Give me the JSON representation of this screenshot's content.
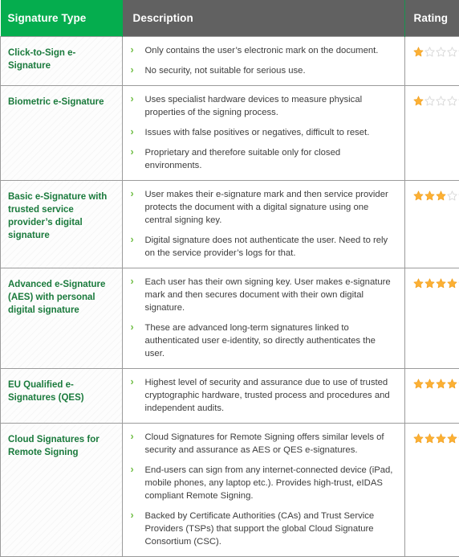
{
  "table": {
    "columns": [
      {
        "id": "type",
        "label": "Signature Type",
        "header_bg": "#05ad4e"
      },
      {
        "id": "description",
        "label": "Description",
        "header_bg": "#616161"
      },
      {
        "id": "rating",
        "label": "Rating",
        "header_bg": "#616161"
      }
    ],
    "max_rating": 5,
    "bullet_glyph": "›",
    "colors": {
      "brand_green": "#05ad4e",
      "header_gray": "#616161",
      "type_text_green": "#1a7a3c",
      "bullet_green": "#6fbe44",
      "star_filled": "#fcb034",
      "star_empty": "#d8d8d8",
      "border_gray": "#9b9b9b",
      "body_text": "#3d3d3d"
    },
    "rows": [
      {
        "type": "Click-to-Sign e-Signature",
        "bullets": [
          "Only contains the user’s electronic mark on the document.",
          "No security, not suitable for serious use."
        ],
        "rating": 1
      },
      {
        "type": "Biometric e-Signature",
        "bullets": [
          "Uses specialist hardware devices to measure physical properties of the signing process.",
          "Issues with false positives or negatives, difficult to reset.",
          "Proprietary and therefore suitable only for closed environments."
        ],
        "rating": 1
      },
      {
        "type": "Basic e-Signature with trusted service provider’s digital signature",
        "bullets": [
          "User makes their e-signature mark and then service provider protects the document with a digital signature using one central signing key.",
          "Digital signature does not authenticate the user. Need to rely on the service provider’s logs for that."
        ],
        "rating": 3
      },
      {
        "type": "Advanced e-Signature (AES) with personal digital signature",
        "bullets": [
          "Each user has their own signing key. User makes e-signature mark and then secures document with their own digital signature.",
          "These are advanced long-term signatures linked to authenticated user e-identity, so directly authenticates the user."
        ],
        "rating": 4
      },
      {
        "type": "EU Qualified e-Signatures (QES)",
        "bullets": [
          "Highest level of security and assurance due to use of trusted cryptographic hardware, trusted process and procedures and independent audits."
        ],
        "rating": 4
      },
      {
        "type": "Cloud Signatures for Remote Signing",
        "bullets": [
          "Cloud Signatures for Remote Signing offers similar levels of security and assurance as AES or QES e-signatures.",
          "End-users can sign from any internet-connected device (iPad, mobile phones, any laptop etc.). Provides high-trust, eIDAS compliant Remote Signing.",
          "Backed by Certificate Authorities (CAs) and Trust Service Providers (TSPs) that support the global Cloud Signature Consortium (CSC)."
        ],
        "rating": 4
      }
    ]
  }
}
